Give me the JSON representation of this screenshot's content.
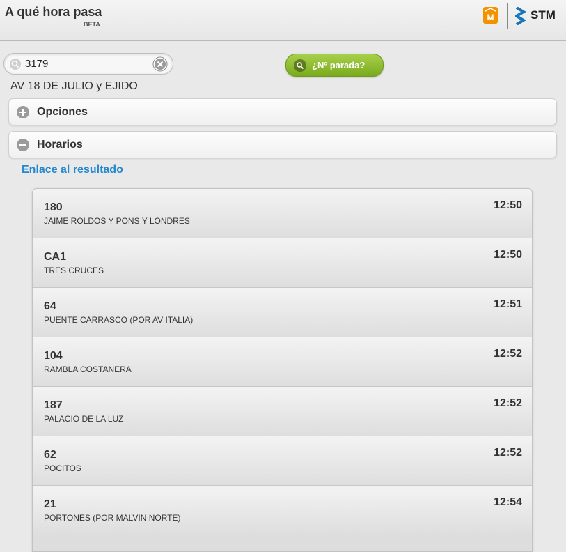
{
  "header": {
    "title": "A qué hora pasa",
    "badge": "BETA",
    "logo_left": "m-logo",
    "logo_right_text": "STM"
  },
  "search": {
    "value": "3179",
    "placeholder": "",
    "button_label": "¿Nº parada?"
  },
  "stop": {
    "name": "AV 18 DE JULIO y EJIDO"
  },
  "sections": {
    "options_label": "Opciones",
    "schedules_label": "Horarios"
  },
  "link": {
    "label": "Enlace al resultado"
  },
  "schedule": [
    {
      "route": "180",
      "destination": "JAIME ROLDOS Y PONS Y LONDRES",
      "time": "12:50"
    },
    {
      "route": "CA1",
      "destination": "TRES CRUCES",
      "time": "12:50"
    },
    {
      "route": "64",
      "destination": "PUENTE CARRASCO (POR AV ITALIA)",
      "time": "12:51"
    },
    {
      "route": "104",
      "destination": "RAMBLA COSTANERA",
      "time": "12:52"
    },
    {
      "route": "187",
      "destination": "PALACIO DE LA LUZ",
      "time": "12:52"
    },
    {
      "route": "62",
      "destination": "POCITOS",
      "time": "12:52"
    },
    {
      "route": "21",
      "destination": "PORTONES (POR MALVIN NORTE)",
      "time": "12:54"
    }
  ],
  "colors": {
    "accent_green": "#8bbd2e",
    "link_blue": "#2489ce",
    "logo_orange": "#f39200",
    "stm_blue": "#1b75bb"
  }
}
